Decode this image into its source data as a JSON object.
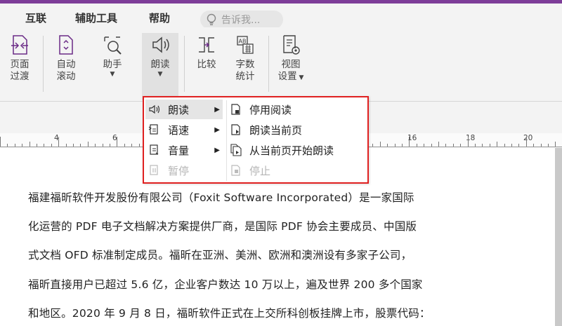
{
  "menubar": {
    "items": [
      "互联",
      "辅助工具",
      "帮助"
    ],
    "tell_me": "告诉我..."
  },
  "ribbon": {
    "buttons": [
      {
        "line1": "页面",
        "line2": "过渡"
      },
      {
        "line1": "自动",
        "line2": "滚动"
      },
      {
        "line1": "助手",
        "line2": ""
      },
      {
        "line1": "朗读",
        "line2": ""
      },
      {
        "line1": "比较",
        "line2": ""
      },
      {
        "line1": "字数",
        "line2": "统计"
      },
      {
        "line1": "视图",
        "line2": "设置"
      }
    ]
  },
  "ruler": {
    "numbers": [
      "4",
      "6",
      "16",
      "18",
      "20"
    ]
  },
  "dropdown": {
    "main": [
      {
        "label": "朗读",
        "icon": "speaker-icon"
      },
      {
        "label": "语速",
        "icon": "speed-icon"
      },
      {
        "label": "音量",
        "icon": "volume-icon"
      },
      {
        "label": "暂停",
        "icon": "pause-icon"
      }
    ],
    "sub": [
      {
        "label": "停用阅读",
        "icon": "stop-read-icon"
      },
      {
        "label": "朗读当前页",
        "icon": "read-page-icon"
      },
      {
        "label": "从当前页开始朗读",
        "icon": "read-from-page-icon"
      },
      {
        "label": "停止",
        "icon": "stop-icon"
      }
    ]
  },
  "document": {
    "lines": [
      "福建福昕软件开发股份有限公司（Foxit Software Incorporated）是一家国际",
      "化运营的 PDF 电子文档解决方案提供厂商，是国际 PDF 协会主要成员、中国版",
      "式文档 OFD 标准制定成员。福昕在亚洲、美洲、欧洲和澳洲设有多家子公司，",
      "福昕直接用户已超过 5.6 亿，企业客户数达 10 万以上，遍及世界 200 多个国家",
      "和地区。2020 年 9 月 8 日，福昕软件正式在上交所科创板挂牌上市，股票代码："
    ]
  },
  "colors": {
    "accent": "#7d3c98",
    "highlight_border": "#e02020"
  }
}
